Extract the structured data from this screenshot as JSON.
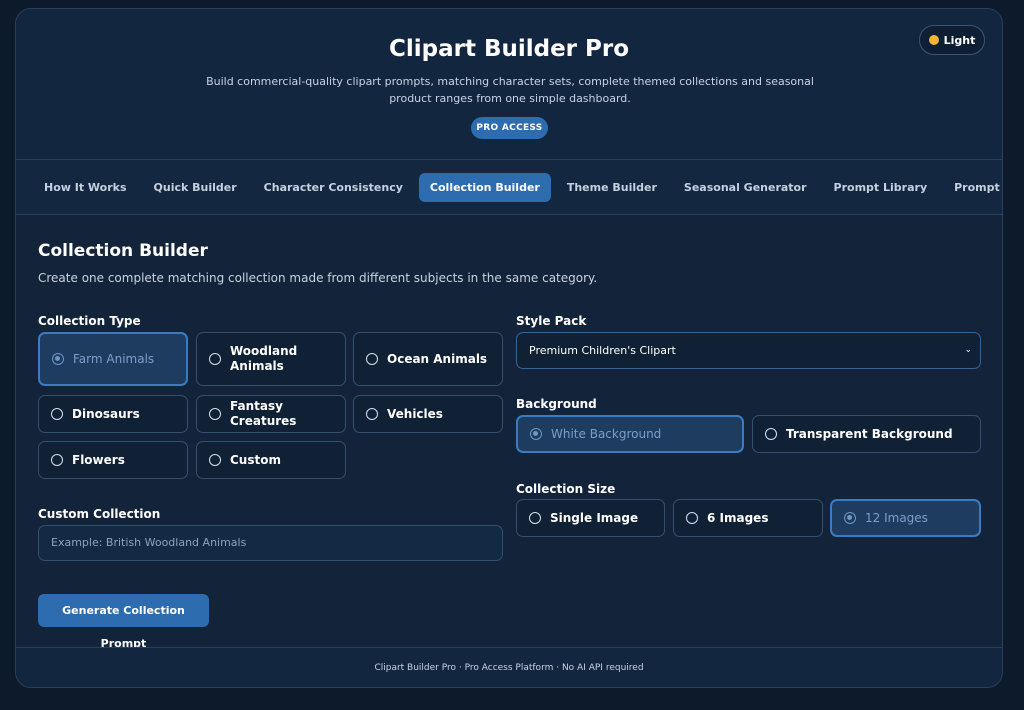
{
  "header": {
    "title": "Clipart Builder Pro",
    "subtitle": "Build commercial-quality clipart prompts, matching character sets, complete themed collections and seasonal product ranges from one simple dashboard.",
    "badge": "PRO ACCESS",
    "theme_toggle": "Light"
  },
  "nav": {
    "tabs": [
      {
        "label": "How It Works",
        "active": false
      },
      {
        "label": "Quick Builder",
        "active": false
      },
      {
        "label": "Character Consistency",
        "active": false
      },
      {
        "label": "Collection Builder",
        "active": true
      },
      {
        "label": "Theme Builder",
        "active": false
      },
      {
        "label": "Seasonal Generator",
        "active": false
      },
      {
        "label": "Prompt Library",
        "active": false
      },
      {
        "label": "Prompt",
        "active": false
      }
    ]
  },
  "main": {
    "title": "Collection Builder",
    "description": "Create one complete matching collection made from different subjects in the same category.",
    "collection_type": {
      "label": "Collection Type",
      "options": [
        {
          "label": "Farm Animals",
          "selected": true
        },
        {
          "label": "Woodland Animals",
          "selected": false
        },
        {
          "label": "Ocean Animals",
          "selected": false
        },
        {
          "label": "Dinosaurs",
          "selected": false
        },
        {
          "label": "Fantasy Creatures",
          "selected": false
        },
        {
          "label": "Vehicles",
          "selected": false
        },
        {
          "label": "Flowers",
          "selected": false
        },
        {
          "label": "Custom",
          "selected": false
        }
      ]
    },
    "custom_collection": {
      "label": "Custom Collection",
      "placeholder": "Example: British Woodland Animals",
      "value": ""
    },
    "style_pack": {
      "label": "Style Pack",
      "selected": "Premium Children's Clipart"
    },
    "background": {
      "label": "Background",
      "options": [
        {
          "label": "White Background",
          "selected": true
        },
        {
          "label": "Transparent Background",
          "selected": false
        }
      ]
    },
    "collection_size": {
      "label": "Collection Size",
      "options": [
        {
          "label": "Single Image",
          "selected": false
        },
        {
          "label": "6 Images",
          "selected": false
        },
        {
          "label": "12 Images",
          "selected": true
        }
      ]
    },
    "generate_button": "Generate Collection Prompt"
  },
  "footer": {
    "text": "Clipart Builder Pro · Pro Access Platform · No AI API required"
  },
  "colors": {
    "accent": "#2d6cae",
    "background": "#0d1a2b",
    "panel": "#13243a"
  }
}
